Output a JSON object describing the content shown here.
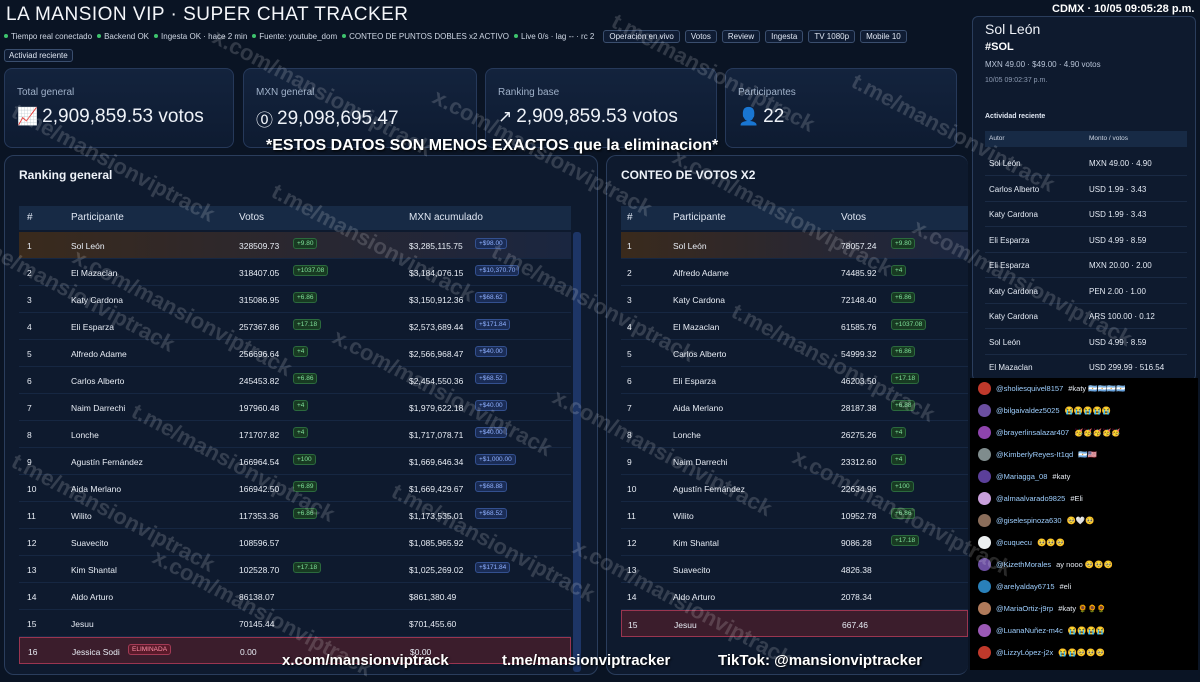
{
  "title": "LA MANSION VIP · SUPER CHAT TRACKER",
  "clock": "CDMX · 10/05 09:05:28 p.m.",
  "status": [
    "Tiempo real conectado",
    "Backend OK",
    "Ingesta OK · hace 2 min",
    "Fuente: youtube_dom",
    "CONTEO DE PUNTOS DOBLES x2 ACTIVO",
    "Live 0/s · lag -- · rc 2"
  ],
  "nav": [
    "Operacion en vivo",
    "Votos",
    "Review",
    "Ingesta",
    "TV 1080p",
    "Mobile 10"
  ],
  "activity_button": "Activiad reciente",
  "cards": [
    {
      "label": "Total general",
      "icon": "chart-icon",
      "value": "2,909,859.53 votos"
    },
    {
      "label": "MXN general",
      "icon": "dollar-icon",
      "value": "29,098,695.47"
    },
    {
      "label": "Ranking base",
      "icon": "trend-icon",
      "value": "2,909,859.53 votos"
    },
    {
      "label": "Participantes",
      "icon": "user-icon",
      "value": "22"
    }
  ],
  "note": "*ESTOS DATOS SON MENOS EXACTOS que la eliminacion*",
  "ranking": {
    "title": "Ranking general",
    "headers": [
      "#",
      "Participante",
      "Votos",
      "MXN acumulado"
    ],
    "rows": [
      {
        "n": "1",
        "name": "Sol León",
        "votes": "328509.73",
        "vbadge": "+9.80",
        "mxn": "$3,285,115.75",
        "mbadge": "+$98.00"
      },
      {
        "n": "2",
        "name": "El Mazaclan",
        "votes": "318407.05",
        "vbadge": "+1037.08",
        "mxn": "$3,184,076.15",
        "mbadge": "+$10,370.70"
      },
      {
        "n": "3",
        "name": "Katy Cardona",
        "votes": "315086.95",
        "vbadge": "+6.86",
        "mxn": "$3,150,912.36",
        "mbadge": "+$68.62"
      },
      {
        "n": "4",
        "name": "Eli Esparza",
        "votes": "257367.86",
        "vbadge": "+17.18",
        "mxn": "$2,573,689.44",
        "mbadge": "+$171.84"
      },
      {
        "n": "5",
        "name": "Alfredo Adame",
        "votes": "256696.64",
        "vbadge": "+4",
        "mxn": "$2,566,968.47",
        "mbadge": "+$40.00"
      },
      {
        "n": "6",
        "name": "Carlos Alberto",
        "votes": "245453.82",
        "vbadge": "+6.86",
        "mxn": "$2,454,550.36",
        "mbadge": "+$68.52"
      },
      {
        "n": "7",
        "name": "Naim Darrechi",
        "votes": "197960.48",
        "vbadge": "+4",
        "mxn": "$1,979,622.18",
        "mbadge": "+$40.00"
      },
      {
        "n": "8",
        "name": "Lonche",
        "votes": "171707.82",
        "vbadge": "+4",
        "mxn": "$1,717,078.71",
        "mbadge": "+$40.00"
      },
      {
        "n": "9",
        "name": "Agustín Fernández",
        "votes": "166964.54",
        "vbadge": "+100",
        "mxn": "$1,669,646.34",
        "mbadge": "+$1,000.00"
      },
      {
        "n": "10",
        "name": "Aida Merlano",
        "votes": "166942.50",
        "vbadge": "+6.89",
        "mxn": "$1,669,429.67",
        "mbadge": "+$68.88"
      },
      {
        "n": "11",
        "name": "Wilito",
        "votes": "117353.36",
        "vbadge": "+6.86",
        "mxn": "$1,173,535.01",
        "mbadge": "+$68.52"
      },
      {
        "n": "12",
        "name": "Suavecito",
        "votes": "108596.57",
        "vbadge": "",
        "mxn": "$1,085,965.92",
        "mbadge": ""
      },
      {
        "n": "13",
        "name": "Kim Shantal",
        "votes": "102528.70",
        "vbadge": "+17.18",
        "mxn": "$1,025,269.02",
        "mbadge": "+$171.84"
      },
      {
        "n": "14",
        "name": "Aldo Arturo",
        "votes": "86138.07",
        "vbadge": "",
        "mxn": "$861,380.49",
        "mbadge": ""
      },
      {
        "n": "15",
        "name": "Jesuu",
        "votes": "70145.44",
        "vbadge": "",
        "mxn": "$701,455.60",
        "mbadge": ""
      },
      {
        "n": "16",
        "name": "Jessica Sodi",
        "votes": "0.00",
        "vbadge": "ELIMINADA",
        "mxn": "$0.00",
        "mbadge": ""
      }
    ]
  },
  "x2": {
    "title": "CONTEO DE VOTOS X2",
    "headers": [
      "#",
      "Participante",
      "Votos"
    ],
    "rows": [
      {
        "n": "1",
        "name": "Sol León",
        "votes": "78057.24",
        "vbadge": "+9.80"
      },
      {
        "n": "2",
        "name": "Alfredo Adame",
        "votes": "74485.92",
        "vbadge": "+4"
      },
      {
        "n": "3",
        "name": "Katy Cardona",
        "votes": "72148.40",
        "vbadge": "+6.86"
      },
      {
        "n": "4",
        "name": "El Mazaclan",
        "votes": "61585.76",
        "vbadge": "+1037.08"
      },
      {
        "n": "5",
        "name": "Carlos Alberto",
        "votes": "54999.32",
        "vbadge": "+6.86"
      },
      {
        "n": "6",
        "name": "Eli Esparza",
        "votes": "46203.50",
        "vbadge": "+17.18"
      },
      {
        "n": "7",
        "name": "Aida Merlano",
        "votes": "28187.38",
        "vbadge": "+6.88"
      },
      {
        "n": "8",
        "name": "Lonche",
        "votes": "26275.26",
        "vbadge": "+4"
      },
      {
        "n": "9",
        "name": "Naim Darrechi",
        "votes": "23312.60",
        "vbadge": "+4"
      },
      {
        "n": "10",
        "name": "Agustín Fernández",
        "votes": "22634.96",
        "vbadge": "+100"
      },
      {
        "n": "11",
        "name": "Wilito",
        "votes": "10952.78",
        "vbadge": "+6.86"
      },
      {
        "n": "12",
        "name": "Kim Shantal",
        "votes": "9086.28",
        "vbadge": "+17.18"
      },
      {
        "n": "13",
        "name": "Suavecito",
        "votes": "4826.38",
        "vbadge": ""
      },
      {
        "n": "14",
        "name": "Aldo Arturo",
        "votes": "2078.34",
        "vbadge": ""
      },
      {
        "n": "15",
        "name": "Jesuu",
        "votes": "667.46",
        "vbadge": ""
      }
    ]
  },
  "detail": {
    "name": "Sol León",
    "tag": "#SOL",
    "sub": "MXN 49.00 · $49.00 · 4.90 votos",
    "time": "10/05 09:02:37 p.m.",
    "activity_title": "Actividad reciente",
    "headers": [
      "Autor",
      "Monto / votos"
    ],
    "rows": [
      {
        "a": "Sol León",
        "m": "MXN 49.00 · 4.90"
      },
      {
        "a": "Carlos Alberto",
        "m": "USD 1.99 · 3.43"
      },
      {
        "a": "Katy Cardona",
        "m": "USD 1.99 · 3.43"
      },
      {
        "a": "Eli Esparza",
        "m": "USD 4.99 · 8.59"
      },
      {
        "a": "Eli Esparza",
        "m": "MXN 20.00 · 2.00"
      },
      {
        "a": "Katy Cardona",
        "m": "PEN 2.00 · 1.00"
      },
      {
        "a": "Katy Cardona",
        "m": "ARS 100.00 · 0.12"
      },
      {
        "a": "Sol León",
        "m": "USD 4.99 · 8.59"
      },
      {
        "a": "El Mazaclan",
        "m": "USD 299.99 · 516.54"
      }
    ]
  },
  "chat": [
    {
      "user": "@sholiesquivel8157",
      "text": "#katy 🇦🇷🇦🇷🇦🇷🇦🇷"
    },
    {
      "user": "@bilgaivaldez5025",
      "text": "😭😭😭😭😭"
    },
    {
      "user": "@brayerlinsalazar407",
      "text": "🥳🥳🥳🥳🥳"
    },
    {
      "user": "@KimberlyReyes-It1qd",
      "text": "🇦🇷🇺🇸"
    },
    {
      "user": "@Mariagga_08",
      "text": "#katy"
    },
    {
      "user": "@almaalvarado9825",
      "text": "#Eli"
    },
    {
      "user": "@giselespinoza630",
      "text": "🥺🤍🥺"
    },
    {
      "user": "@cuquecu",
      "text": "🥺🥺🥺"
    },
    {
      "user": "@KizethMorales",
      "text": "ay nooo 🥺🥺🥺"
    },
    {
      "user": "@arelyalday6715",
      "text": "#eli"
    },
    {
      "user": "@MariaOrtiz-j9rp",
      "text": "#katy 🌻🌻🌻"
    },
    {
      "user": "@LuanaNuñez-m4c",
      "text": "😭😭😭😭"
    },
    {
      "user": "@LizzyLópez-j2x",
      "text": "😭😭🥺🥺🥺"
    }
  ],
  "watermarks": [
    "t.me/mansionviptrack",
    "x.com/mansionviptrack"
  ],
  "footer": [
    "x.com/mansionviptrack",
    "t.me/mansionviptracker",
    "TikTok: @mansionviptracker"
  ]
}
